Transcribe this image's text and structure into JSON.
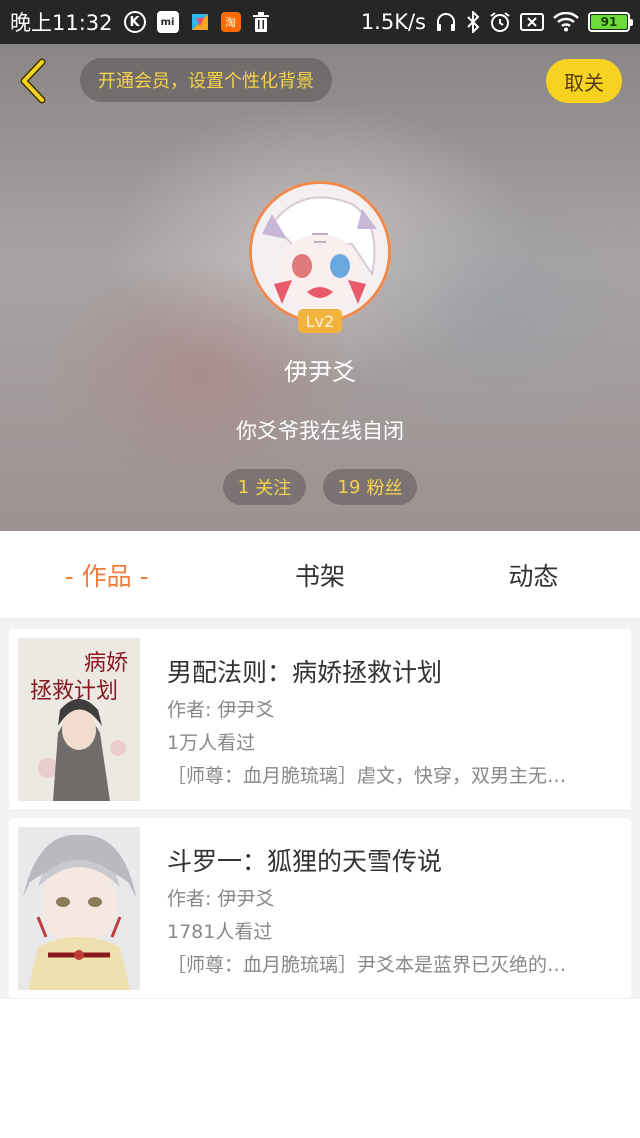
{
  "status_bar": {
    "time": "晚上11:32",
    "k_icon": "K",
    "mi_icon": "mi",
    "tao_icon": "淘",
    "net_speed": "1.5K/s",
    "battery": "91"
  },
  "header": {
    "vip_banner": "开通会员，设置个性化背景",
    "cancel_label": "取关"
  },
  "profile": {
    "level": "Lv2",
    "username": "伊尹爻",
    "signature": "你爻爷我在线自闭",
    "follow_count": "1",
    "follow_label": "关注",
    "fans_count": "19",
    "fans_label": "粉丝"
  },
  "tabs": [
    {
      "label": "- 作品 -"
    },
    {
      "label": "书架"
    },
    {
      "label": "动态"
    }
  ],
  "works": [
    {
      "title": "男配法则：病娇拯救计划",
      "author": "作者: 伊尹爻",
      "views": "1万人看过",
      "desc": "［师尊：血月脆琉璃］虐文，快穿，双男主无…",
      "cover_text": "病娇拯救计划"
    },
    {
      "title": "斗罗一：狐狸的天雪传说",
      "author": "作者: 伊尹爻",
      "views": "1781人看过",
      "desc": "［师尊：血月脆琉璃］尹爻本是蓝界已灭绝的…"
    }
  ]
}
